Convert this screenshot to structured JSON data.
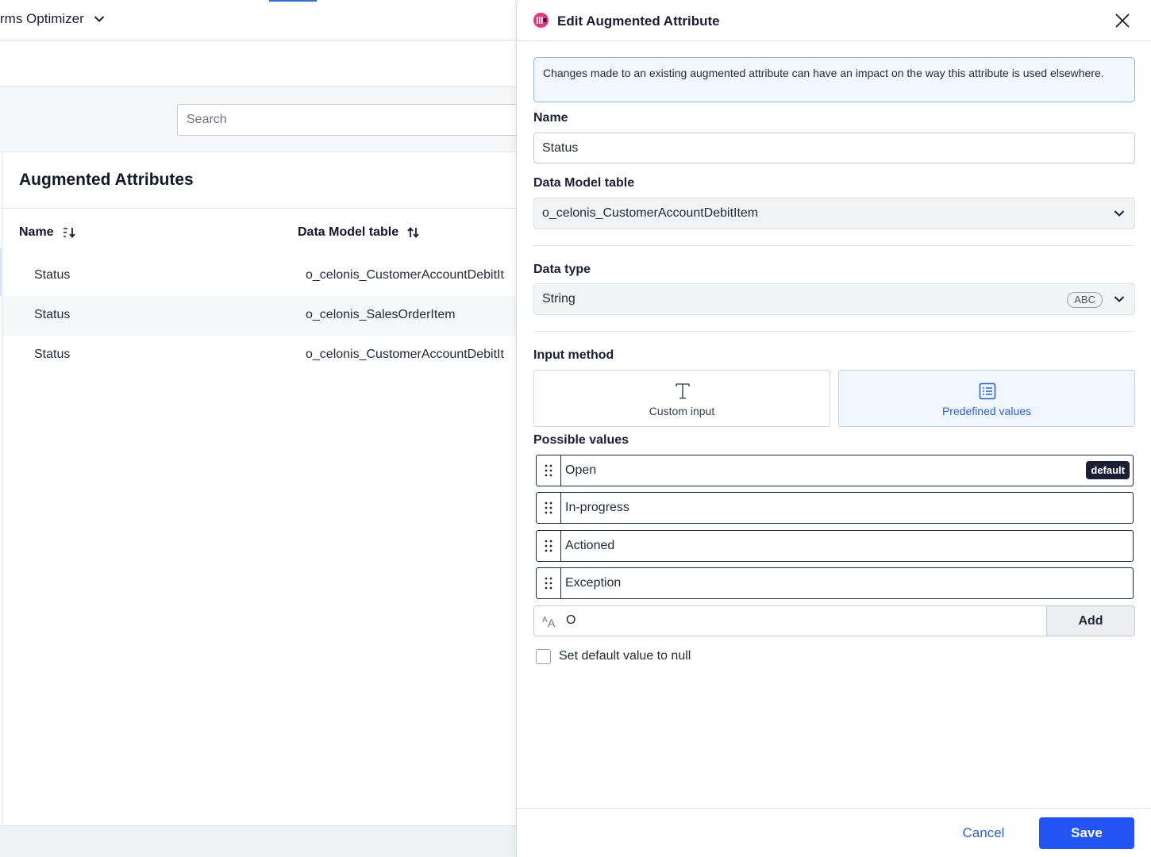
{
  "app": {
    "title": "rms Optimizer"
  },
  "search": {
    "placeholder": "Search"
  },
  "list": {
    "title": "Augmented Attributes",
    "columns": [
      "Name",
      "Data Model table"
    ],
    "rows": [
      {
        "name": "Status",
        "table": "o_celonis_CustomerAccountDebitIt"
      },
      {
        "name": "Status",
        "table": "o_celonis_SalesOrderItem"
      },
      {
        "name": "Status",
        "table": "o_celonis_CustomerAccountDebitIt"
      }
    ]
  },
  "modal": {
    "title": "Edit Augmented Attribute",
    "info": "Changes made to an existing augmented attribute can have an impact on the way this attribute is used elsewhere.",
    "name_label": "Name",
    "name_value": "Status",
    "table_label": "Data Model table",
    "table_value": "o_celonis_CustomerAccountDebitItem",
    "type_label": "Data type",
    "type_value": "String",
    "type_badge": "ABC",
    "method_label": "Input method",
    "methods": {
      "custom": "Custom input",
      "predefined": "Predefined values"
    },
    "possible_label": "Possible values",
    "values": [
      "Open",
      "In-progress",
      "Actioned",
      "Exception"
    ],
    "default_badge": "default",
    "new_value": "O",
    "add_label": "Add",
    "null_label": "Set default value to null",
    "cancel_label": "Cancel",
    "save_label": "Save"
  },
  "colors": {
    "primary": "#2154f2",
    "info_border": "#84b5f5",
    "info_bg": "#f3f8ff",
    "selected_bg": "#f1f7fe",
    "dark": "#1a1f36"
  },
  "icons": {
    "app_chevron": "chevron-down-icon",
    "sort_name": "sort-descending-icon",
    "sort_table": "sort-arrows-icon",
    "logo": "celonis-logo-icon",
    "close": "close-icon",
    "custom": "text-t-icon",
    "predefined": "list-icon",
    "drag": "drag-handle-icon",
    "text_format": "text-format-icon"
  }
}
